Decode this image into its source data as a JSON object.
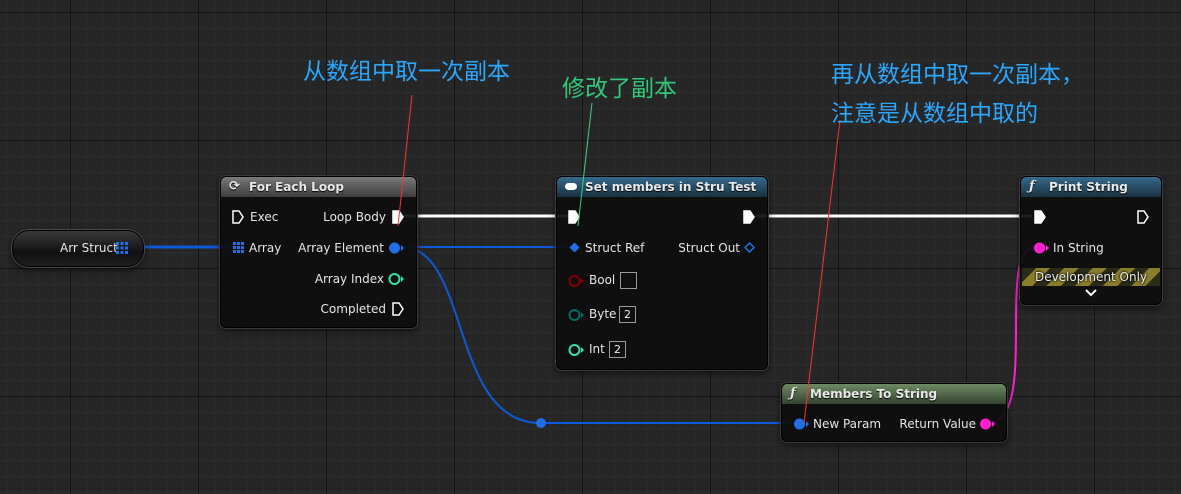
{
  "colors": {
    "exec": "#ffffff",
    "struct": "#0d5ad8",
    "struct_pin": "#1f6fe8",
    "string": "#ff1fd0",
    "int": "#2ee3a6",
    "bool": "#8a0000",
    "byte": "#006b64",
    "annotation_blue": "#29a8ff",
    "annotation_green": "#2fc97a",
    "annotation_line_red": "#ff3030",
    "annotation_line_green": "#40d080"
  },
  "variable_node": {
    "label": "Arr Struct",
    "icon": "array-grid-icon"
  },
  "for_each_loop": {
    "title": "For Each Loop",
    "icon": "loop-icon",
    "inputs": {
      "exec": "Exec",
      "array": "Array"
    },
    "outputs": {
      "loop_body": "Loop Body",
      "array_element": "Array Element",
      "array_index": "Array Index",
      "completed": "Completed"
    }
  },
  "set_members": {
    "title": "Set members in Stru Test",
    "icon": "struct-pill-icon",
    "inputs": {
      "struct_ref": "Struct Ref",
      "bool": "Bool",
      "byte": "Byte",
      "byte_value": "2",
      "int": "Int",
      "int_value": "2"
    },
    "outputs": {
      "struct_out": "Struct Out"
    }
  },
  "print_string": {
    "title": "Print String",
    "icon": "function-icon",
    "inputs": {
      "in_string": "In String"
    },
    "footer": "Development Only",
    "expand_icon": "chevron-down-icon"
  },
  "members_to_string": {
    "title": "Members To String",
    "icon": "function-icon",
    "inputs": {
      "new_param": "New Param"
    },
    "outputs": {
      "return_value": "Return Value"
    }
  },
  "annotations": {
    "first_copy": "从数组中取一次副本",
    "modified_copy": "修改了副本",
    "second_copy_line1": "再从数组中取一次副本，",
    "second_copy_line2": "注意是从数组中取的"
  }
}
